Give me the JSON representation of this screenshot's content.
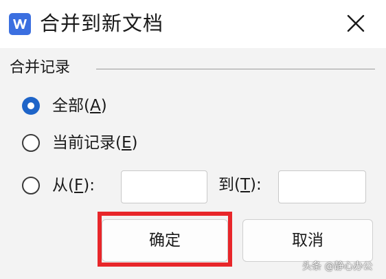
{
  "window": {
    "title": "合并到新文档",
    "app_icon": "wps-writer-icon",
    "close_icon": "close-icon"
  },
  "group": {
    "label": "合并记录"
  },
  "options": {
    "all": {
      "label_prefix": "全部(",
      "accel": "A",
      "label_suffix": ")",
      "checked": true
    },
    "current": {
      "label_prefix": "当前记录(",
      "accel": "E",
      "label_suffix": ")",
      "checked": false
    },
    "range": {
      "label_prefix": "从(",
      "accel": "F",
      "label_suffix": "):",
      "checked": false
    }
  },
  "range_fields": {
    "from_value": "",
    "to_label_prefix": "到(",
    "to_accel": "T",
    "to_label_suffix": "):",
    "to_value": ""
  },
  "buttons": {
    "ok": "确定",
    "cancel": "取消"
  },
  "colors": {
    "accent": "#1e64c8",
    "highlight": "#e8262a",
    "logo": "#3b6fe0"
  },
  "watermark": "头条 @静心办公"
}
